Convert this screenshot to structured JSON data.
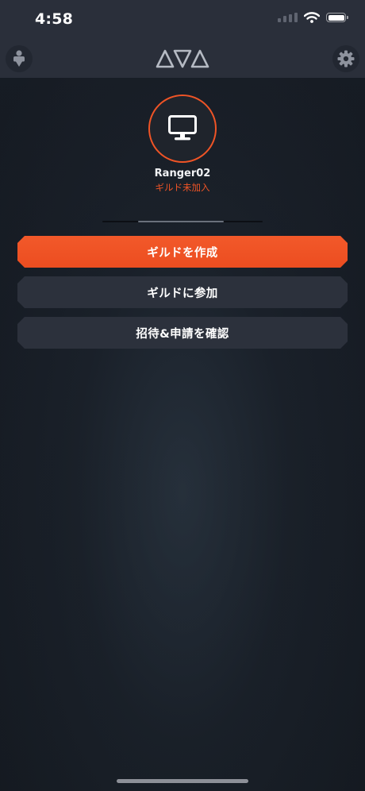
{
  "status_bar": {
    "time": "4:58",
    "battery_level": 1.0
  },
  "header": {
    "left_icon": "user-icon",
    "logo_icon": "ava-logo-icon",
    "right_icon": "gear-icon"
  },
  "profile": {
    "avatar_icon": "monitor-icon",
    "username": "Ranger02",
    "guild_status": "ギルド未加入"
  },
  "actions": {
    "create_guild": "ギルドを作成",
    "join_guild": "ギルドに参加",
    "check_invites": "招待&申請を確認"
  },
  "colors": {
    "accent": "#EF5426",
    "button_secondary": "#2C313C",
    "header_background": "#2A2F3A",
    "screen_background": "#131820"
  }
}
